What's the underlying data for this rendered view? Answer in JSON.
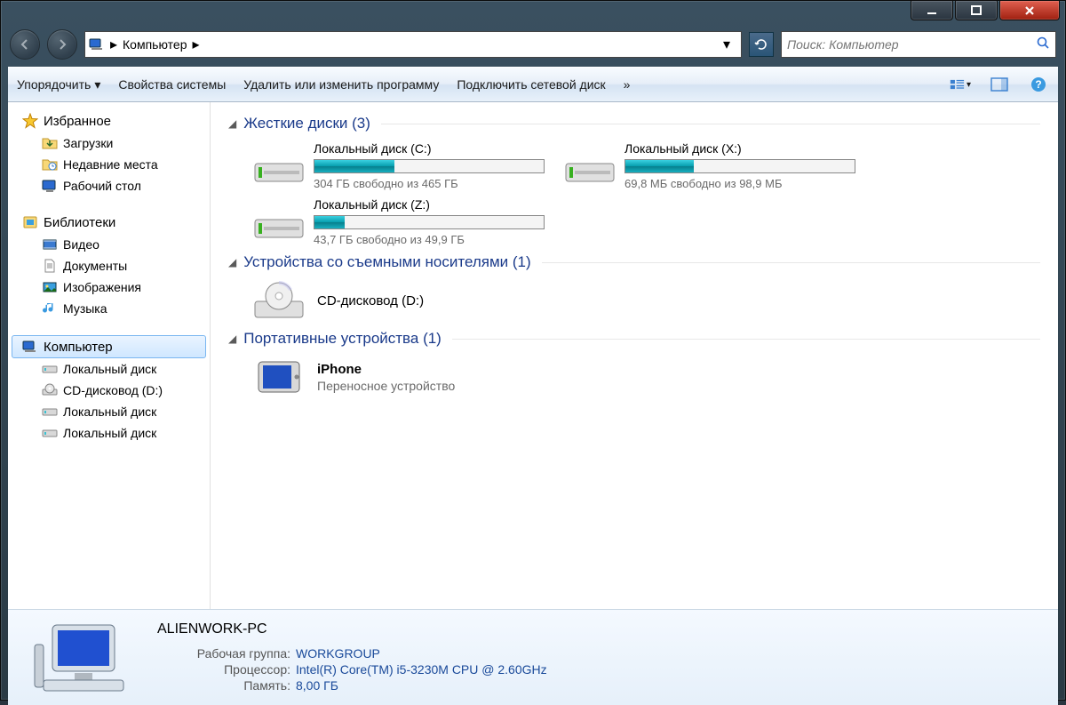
{
  "titlebar": {
    "minimize": "—",
    "maximize": "☐",
    "close": "✕"
  },
  "nav": {
    "location": "Компьютер",
    "search_placeholder": "Поиск: Компьютер"
  },
  "toolbar": {
    "organize": "Упорядочить",
    "system_props": "Свойства системы",
    "uninstall": "Удалить или изменить программу",
    "map_drive": "Подключить сетевой диск",
    "overflow": "»"
  },
  "sidebar": {
    "favorites": {
      "label": "Избранное",
      "items": [
        {
          "label": "Загрузки"
        },
        {
          "label": "Недавние места"
        },
        {
          "label": "Рабочий стол"
        }
      ]
    },
    "libraries": {
      "label": "Библиотеки",
      "items": [
        {
          "label": "Видео"
        },
        {
          "label": "Документы"
        },
        {
          "label": "Изображения"
        },
        {
          "label": "Музыка"
        }
      ]
    },
    "computer": {
      "label": "Компьютер",
      "items": [
        {
          "label": "Локальный диск"
        },
        {
          "label": "CD-дисковод (D:)"
        },
        {
          "label": "Локальный диск"
        },
        {
          "label": "Локальный диск"
        }
      ]
    }
  },
  "sections": {
    "hdd": {
      "title": "Жесткие диски (3)",
      "drives": [
        {
          "name": "Локальный диск (C:)",
          "free": "304 ГБ свободно из 465 ГБ",
          "used_pct": 35
        },
        {
          "name": "Локальный диск (X:)",
          "free": "69,8 МБ свободно из 98,9 МБ",
          "used_pct": 30
        },
        {
          "name": "Локальный диск (Z:)",
          "free": "43,7 ГБ свободно из 49,9 ГБ",
          "used_pct": 13
        }
      ]
    },
    "removable": {
      "title": "Устройства со съемными носителями (1)",
      "devices": [
        {
          "name": "CD-дисковод (D:)"
        }
      ]
    },
    "portable": {
      "title": "Портативные устройства (1)",
      "devices": [
        {
          "name": "iPhone",
          "type": "Переносное устройство"
        }
      ]
    }
  },
  "details": {
    "pc_name": "ALIENWORK-PC",
    "workgroup_key": "Рабочая группа:",
    "workgroup_val": "WORKGROUP",
    "cpu_key": "Процессор:",
    "cpu_val": "Intel(R) Core(TM) i5-3230M CPU @ 2.60GHz",
    "ram_key": "Память:",
    "ram_val": "8,00 ГБ"
  }
}
